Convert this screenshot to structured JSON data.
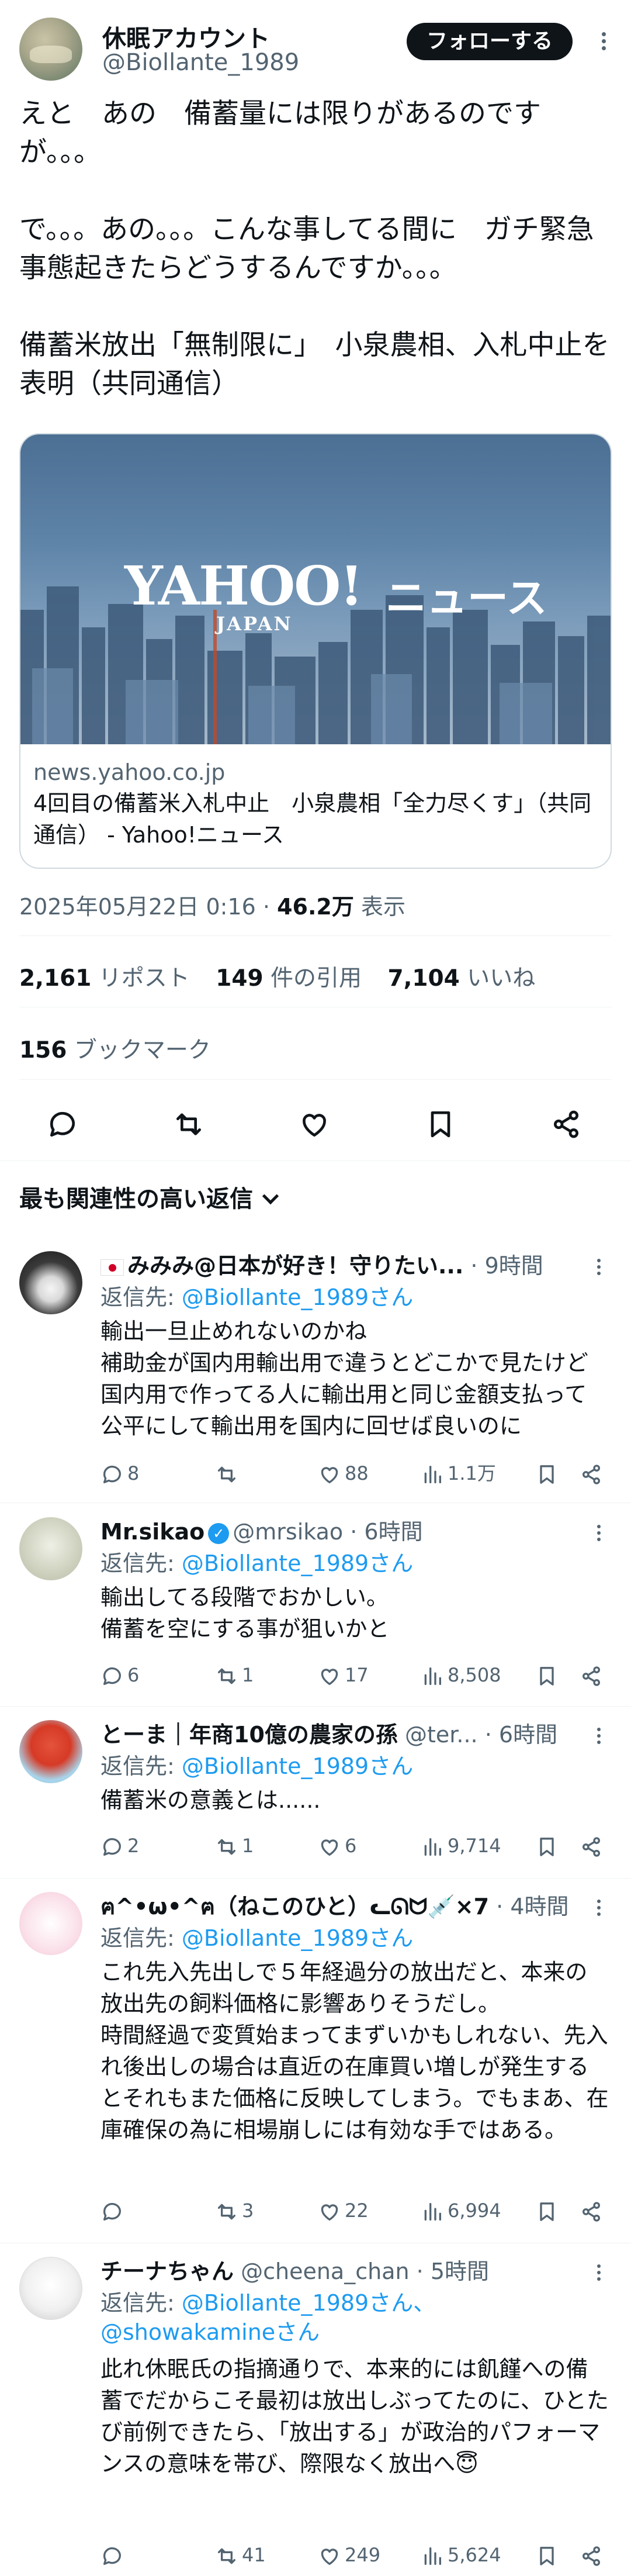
{
  "post": {
    "display_name": "休眠アカウント",
    "handle": "@Biollante_1989",
    "follow_label": "フォローする",
    "text": "えと　あの　備蓄量には限りがあるのですが。。。\n\nで。。。あの。。。こんな事してる間に　ガチ緊急事態起きたらどうするんですか。。。\n\n備蓄米放出「無制限に」　小泉農相、入札中止を表明（共同通信）",
    "card": {
      "logo_yahoo": "YAHOO!",
      "logo_japan": "JAPAN",
      "logo_news": "ニュース",
      "domain": "news.yahoo.co.jp",
      "title": "4回目の備蓄米入札中止　小泉農相「全力尽くす」（共同通信） - Yahoo!ニュース"
    },
    "timestamp": "2025年05月22日 0:16",
    "separator": "·",
    "views_count": "46.2万",
    "views_label": "表示",
    "reposts_count": "2,161",
    "reposts_label": "リポスト",
    "quotes_count": "149",
    "quotes_label": "件の引用",
    "likes_count": "7,104",
    "likes_label": "いいね",
    "bookmarks_count": "156",
    "bookmarks_label": "ブックマーク"
  },
  "actions": {
    "icons": [
      "reply-icon",
      "repost-icon",
      "like-icon",
      "bookmark-icon",
      "share-icon"
    ]
  },
  "replies_header": "最も関連性の高い返信",
  "replies": [
    {
      "name": "みみみ@日本が好き！守りたい...",
      "handle": "",
      "time": "9時間",
      "reply_to_label": "返信先: ",
      "reply_to": "@Biollante_1989さん",
      "body": "輸出一旦止めれないのかね\n補助金が国内用輸出用で違うとどこかで見たけど国内用で作ってる人に輸出用と同じ金額支払って公平にして輸出用を国内に回せば良いのに",
      "replies": "8",
      "reposts": "",
      "likes": "88",
      "views": "1.1万"
    },
    {
      "name": "Mr.sikao",
      "handle": "@mrsikao",
      "time": "6時間",
      "reply_to_label": "返信先: ",
      "reply_to": "@Biollante_1989さん",
      "body": "輸出してる段階でおかしい。\n備蓄を空にする事が狙いかと",
      "replies": "6",
      "reposts": "1",
      "likes": "17",
      "views": "8,508"
    },
    {
      "name": "とーま｜年商10億の農家の孫",
      "handle": "@ter...",
      "time": "6時間",
      "reply_to_label": "返信先: ",
      "reply_to": "@Biollante_1989さん",
      "body": "備蓄米の意義とは......",
      "replies": "2",
      "reposts": "1",
      "likes": "6",
      "views": "9,714"
    },
    {
      "name": "ฅ^•ω•^ฅ（ねこのひと）ᓚᘏᗢ💉×7",
      "handle": "",
      "time": "4時間",
      "reply_to_label": "返信先: ",
      "reply_to": "@Biollante_1989さん",
      "body": "これ先入先出しで５年経過分の放出だと、本来の放出先の飼料価格に影響ありそうだし。\n時間経過で変質始まってまずいかもしれない、先入れ後出しの場合は直近の在庫買い増しが発生するとそれもまた価格に反映してしまう。でもまあ、在庫確保の為に相場崩しには有効な手ではある。",
      "replies": "",
      "reposts": "3",
      "likes": "22",
      "views": "6,994"
    },
    {
      "name": "チーナちゃん",
      "handle": "@cheena_chan",
      "time": "5時間",
      "reply_to_label": "返信先: ",
      "reply_to": "@Biollante_1989さん、@showakamineさん",
      "body": "此れ休眠氏の指摘通りで、本来的には飢饉への備蓄でだからこそ最初は放出しぶってたのに、ひとたび前例できたら、「放出する」が政治的パフォーマンスの意味を帯び、際限なく放出へ😇",
      "replies": "",
      "reposts": "41",
      "likes": "249",
      "views": "5,624"
    }
  ]
}
